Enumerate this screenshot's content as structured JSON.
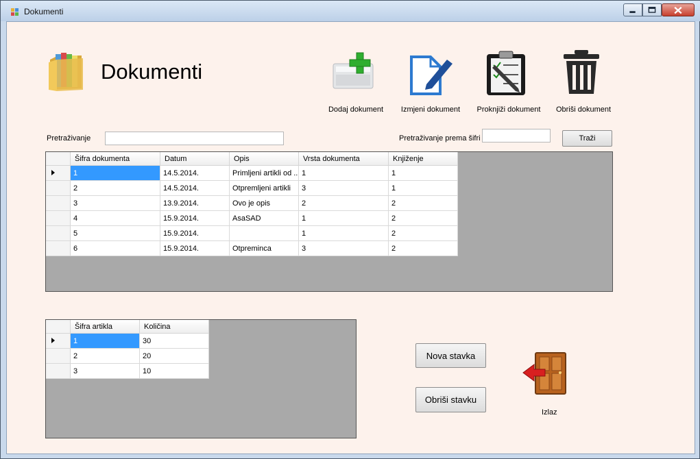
{
  "window": {
    "title": "Dokumenti",
    "min_label": "0",
    "max_label": "1",
    "close_label": "r"
  },
  "header": {
    "title": "Dokumenti"
  },
  "toolbar": {
    "add_label": "Dodaj dokument",
    "edit_label": "Izmjeni dokument",
    "post_label": "Proknjiži dokument",
    "delete_label": "Obriši dokument"
  },
  "search": {
    "label": "Pretraživanje",
    "value": "",
    "code_label": "Pretraživanje prema šifri",
    "code_value": "",
    "button_label": "Traži"
  },
  "documents": {
    "columns": [
      "Šifra dokumenta",
      "Datum",
      "Opis",
      "Vrsta dokumenta",
      "Knjiženje"
    ],
    "rows": [
      [
        "1",
        "14.5.2014.",
        "Primljeni artikli od ...",
        "1",
        "1"
      ],
      [
        "2",
        "14.5.2014.",
        "Otpremljeni artikli",
        "3",
        "1"
      ],
      [
        "3",
        "13.9.2014.",
        "Ovo je opis",
        "2",
        "2"
      ],
      [
        "4",
        "15.9.2014.",
        "AsaSAD",
        "1",
        "2"
      ],
      [
        "5",
        "15.9.2014.",
        "",
        "1",
        "2"
      ],
      [
        "6",
        "15.9.2014.",
        "Otpreminca",
        "3",
        "2"
      ]
    ]
  },
  "items": {
    "columns": [
      "Šifra artikla",
      "Količina"
    ],
    "rows": [
      [
        "1",
        "30"
      ],
      [
        "2",
        "20"
      ],
      [
        "3",
        "10"
      ]
    ]
  },
  "actions": {
    "new_item_label": "Nova stavka",
    "delete_item_label": "Obriši stavku",
    "exit_label": "Izlaz"
  }
}
